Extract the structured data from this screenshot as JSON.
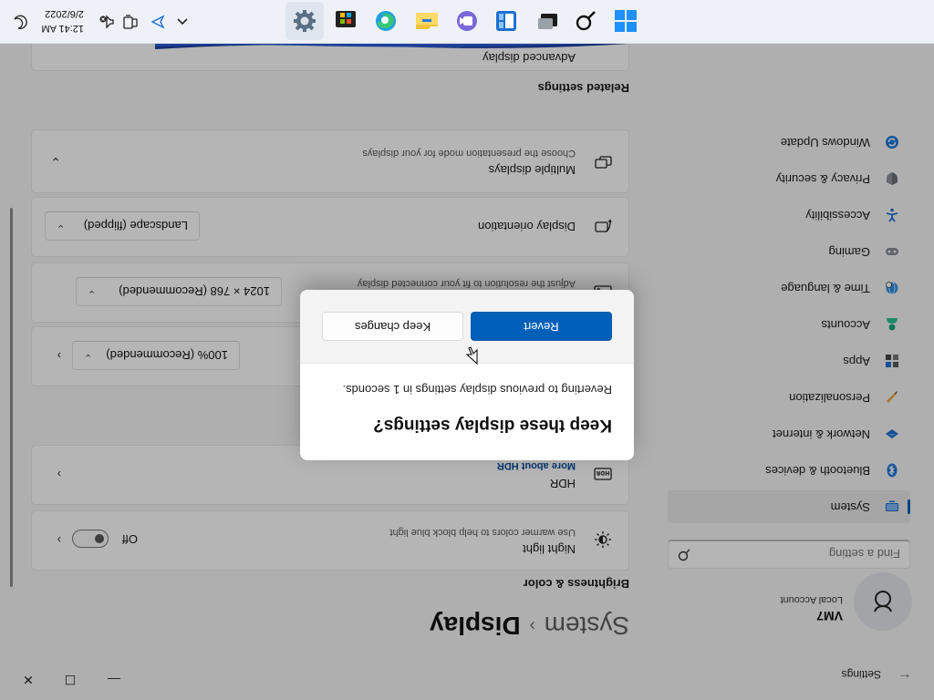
{
  "window": {
    "app_title": "Settings",
    "controls": {
      "minimize": "—",
      "maximize": "☐",
      "close": "✕"
    }
  },
  "profile": {
    "name": "VM7",
    "account_type": "Local Account"
  },
  "search": {
    "placeholder": "Find a setting"
  },
  "nav": {
    "items": [
      {
        "label": "System",
        "icon": "system-icon"
      },
      {
        "label": "Bluetooth & devices",
        "icon": "bluetooth-icon"
      },
      {
        "label": "Network & internet",
        "icon": "network-icon"
      },
      {
        "label": "Personalization",
        "icon": "brush-icon"
      },
      {
        "label": "Apps",
        "icon": "apps-icon"
      },
      {
        "label": "Accounts",
        "icon": "accounts-icon"
      },
      {
        "label": "Time & language",
        "icon": "globe-clock-icon"
      },
      {
        "label": "Gaming",
        "icon": "gamepad-icon"
      },
      {
        "label": "Accessibility",
        "icon": "accessibility-icon"
      },
      {
        "label": "Privacy & security",
        "icon": "shield-icon"
      },
      {
        "label": "Windows Update",
        "icon": "update-icon"
      }
    ],
    "active_index": 0
  },
  "breadcrumb": {
    "root": "System",
    "separator": "›",
    "current": "Display"
  },
  "brightness_section": {
    "title": "Brightness & color"
  },
  "night_light": {
    "title": "Night light",
    "subtitle": "Use warmer colors to help block blue light",
    "toggle_label": "Off",
    "toggle_state": "off"
  },
  "hdr": {
    "title": "HDR",
    "link": "More about HDR"
  },
  "scale": {
    "value": "100% (Recommended)"
  },
  "resolution": {
    "subtitle": "Adjust the resolution to fit your connected display",
    "value": "1024 × 768 (Recommended)"
  },
  "orientation": {
    "title": "Display orientation",
    "value": "Landscape (flipped)"
  },
  "multiple_displays": {
    "title": "Multiple displays",
    "subtitle": "Choose the presentation mode for your displays"
  },
  "related_section": {
    "title": "Related settings"
  },
  "advanced_display": {
    "title": "Advanced display"
  },
  "dialog": {
    "title": "Keep these display settings?",
    "message": "Reverting to previous display settings in  1 seconds.",
    "primary_button": "Revert",
    "secondary_button": "Keep changes"
  },
  "taskbar": {
    "time": "12:41 AM",
    "date": "2/6/2022",
    "pinned": [
      "start-icon",
      "search-icon",
      "task-view-icon",
      "widgets-icon",
      "teams-chat-icon",
      "file-explorer-icon",
      "edge-icon",
      "store-icon",
      "settings-icon"
    ]
  },
  "colors": {
    "accent": "#005fb8",
    "background": "#f3f3f3",
    "card": "#fbfbfb"
  }
}
